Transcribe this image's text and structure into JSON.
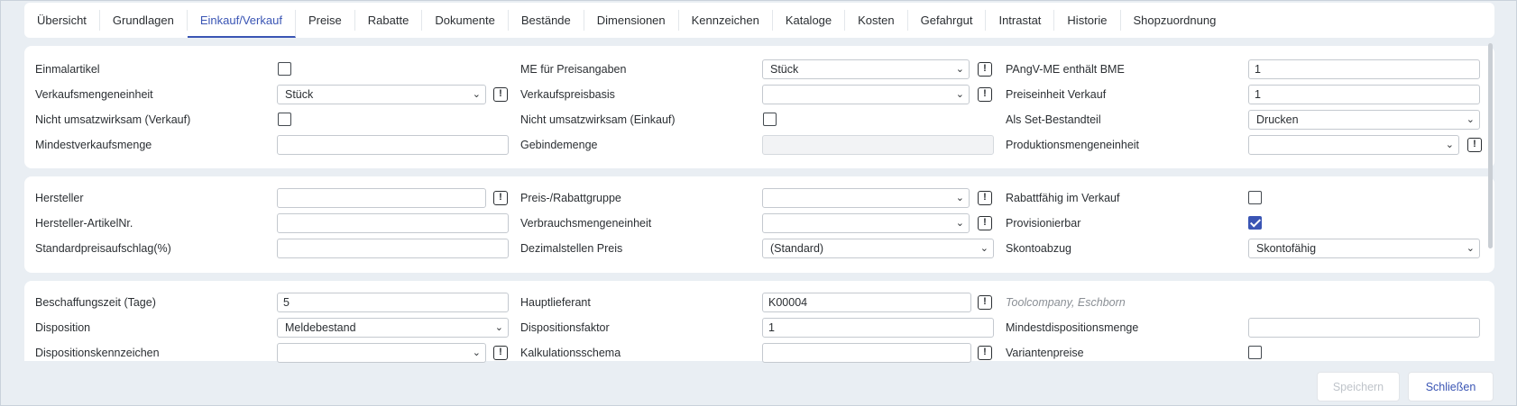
{
  "tabs": [
    "Übersicht",
    "Grundlagen",
    "Einkauf/Verkauf",
    "Preise",
    "Rabatte",
    "Dokumente",
    "Bestände",
    "Dimensionen",
    "Kennzeichen",
    "Kataloge",
    "Kosten",
    "Gefahrgut",
    "Intrastat",
    "Historie",
    "Shopzuordnung"
  ],
  "active_tab": "Einkauf/Verkauf",
  "section1": {
    "einmalartikel": "Einmalartikel",
    "me_preisangaben": "ME für Preisangaben",
    "me_preisangaben_value": "Stück",
    "pangv": "PAngV-ME enthält BME",
    "pangv_value": "1",
    "vme": "Verkaufsmengeneinheit",
    "vme_value": "Stück",
    "vpb": "Verkaufspreisbasis",
    "vpb_value": "",
    "pev": "Preiseinheit Verkauf",
    "pev_value": "1",
    "nuv": "Nicht umsatzwirksam (Verkauf)",
    "nue": "Nicht umsatzwirksam (Einkauf)",
    "set": "Als Set-Bestandteil",
    "set_value": "Drucken",
    "mvm": "Mindestverkaufsmenge",
    "mvm_value": "",
    "gbm": "Gebindemenge",
    "gbm_value": "",
    "pme": "Produktionsmengeneinheit",
    "pme_value": ""
  },
  "section2": {
    "hersteller": "Hersteller",
    "hersteller_value": "",
    "prg": "Preis-/Rabattgruppe",
    "prg_value": "",
    "rabatt": "Rabattfähig im Verkauf",
    "han": "Hersteller-ArtikelNr.",
    "han_value": "",
    "vbme": "Verbrauchsmengeneinheit",
    "vbme_value": "",
    "prov": "Provisionierbar",
    "spa": "Standardpreisaufschlag(%)",
    "spa_value": "",
    "dsp": "Dezimalstellen Preis",
    "dsp_value": "(Standard)",
    "skonto": "Skontoabzug",
    "skonto_value": "Skontofähig"
  },
  "section3": {
    "bz": "Beschaffungszeit (Tage)",
    "bz_value": "5",
    "hl": "Hauptlieferant",
    "hl_value": "K00004",
    "hl_name": "Toolcompany, Eschborn",
    "disp": "Disposition",
    "disp_value": "Meldebestand",
    "dispf": "Dispositionsfaktor",
    "dispf_value": "1",
    "mdm": "Mindestdispositionsmenge",
    "mdm_value": "",
    "dk": "Dispositionskennzeichen",
    "dk_value": "",
    "ks": "Kalkulationsschema",
    "ks_value": "",
    "vp": "Variantenpreise"
  },
  "footer": {
    "save": "Speichern",
    "close": "Schließen"
  },
  "colors": {
    "accent": "#3a55b4",
    "background": "#e9eef3"
  },
  "icons": {
    "info": "!",
    "chevron": "⌄"
  }
}
